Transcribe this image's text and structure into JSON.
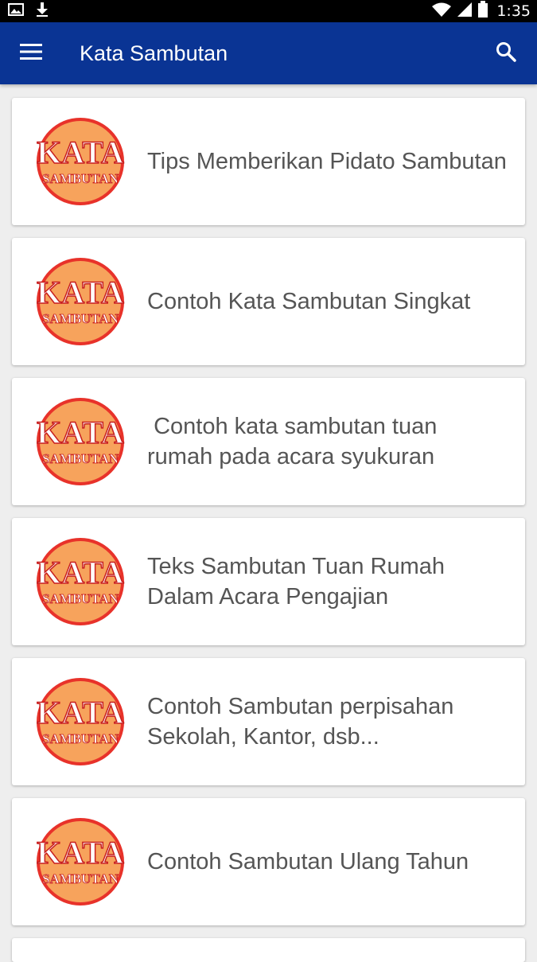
{
  "status_bar": {
    "time": "1:35",
    "icons": [
      "image-icon",
      "download-icon",
      "wifi-icon",
      "signal-icon",
      "battery-icon"
    ]
  },
  "app_bar": {
    "title": "Kata Sambutan",
    "menu_icon": "hamburger-menu-icon",
    "search_icon": "search-icon",
    "color": "#0a3494"
  },
  "logo": {
    "line1": "KATA",
    "line2": "SAMBUTAN",
    "ring_color": "#e8322a",
    "fill_color": "#f7a35c"
  },
  "items": [
    {
      "title": "Tips Memberikan Pidato Sambutan"
    },
    {
      "title": "Contoh Kata Sambutan Singkat"
    },
    {
      "title": " Contoh kata sambutan tuan rumah pada acara syukuran"
    },
    {
      "title": "Teks Sambutan Tuan Rumah Dalam Acara Pengajian"
    },
    {
      "title": "Contoh Sambutan perpisahan Sekolah, Kantor, dsb..."
    },
    {
      "title": "Contoh Sambutan Ulang Tahun"
    }
  ]
}
